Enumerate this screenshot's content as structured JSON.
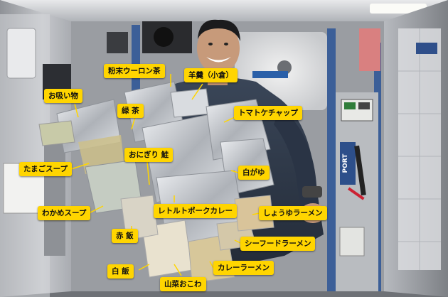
{
  "labels": {
    "funmatsu_oolong": "粉末ウーロン茶",
    "yokan": "羊羹（小倉）",
    "osuimono": "お吸い物",
    "ryokucha": "緑 茶",
    "tomato_ketchup": "トマトケチャップ",
    "onigiri_sake": "おにぎり 鮭",
    "tamago_soup": "たまごスープ",
    "shiragayu": "白がゆ",
    "wakame_soup": "わかめスープ",
    "retort_pork_curry": "レトルトポークカレー",
    "shoyu_ramen": "しょうゆラーメン",
    "sekihan": "赤 飯",
    "seafood_ramen": "シーフードラーメン",
    "hakuhan": "白 飯",
    "curry_ramen": "カレーラーメン",
    "sansai_okowa": "山菜おこわ"
  },
  "module_signs": {
    "port": "PORT"
  },
  "colors": {
    "label_bg": "#ffd500",
    "label_text": "#111111",
    "leader_line": "#ffd500",
    "module_wall": "#d9dadc",
    "shirt": "#2f3a4d",
    "foil": "#c9ccd1"
  }
}
